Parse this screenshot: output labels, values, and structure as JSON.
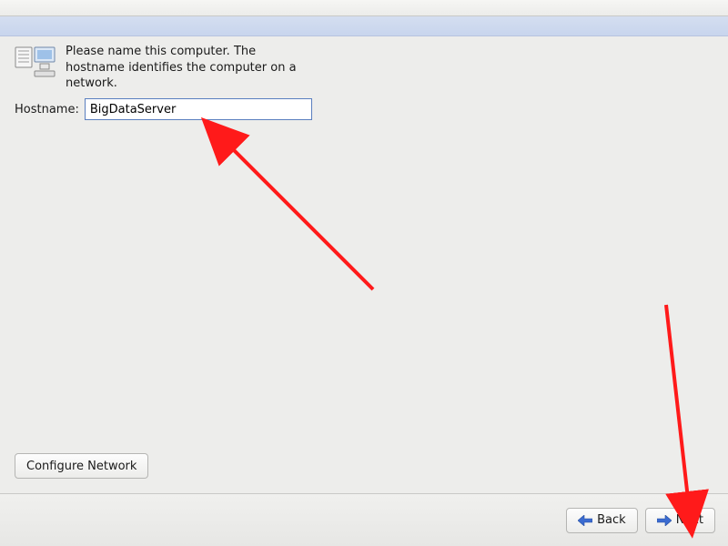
{
  "instruction_text": "Please name this computer.  The hostname identifies the computer on a network.",
  "hostname": {
    "label": "Hostname:",
    "value": "BigDataServer"
  },
  "buttons": {
    "configure_network": "Configure Network",
    "back": "Back",
    "next": "Next"
  },
  "icons": {
    "computer": "computer-network-icon",
    "arrow_left": "arrow-left-icon",
    "arrow_right": "arrow-right-icon"
  },
  "colors": {
    "input_border": "#5a7fbf",
    "accent_arrow_blue": "#3b6bd1",
    "annotation_red": "#ff1a1a"
  }
}
